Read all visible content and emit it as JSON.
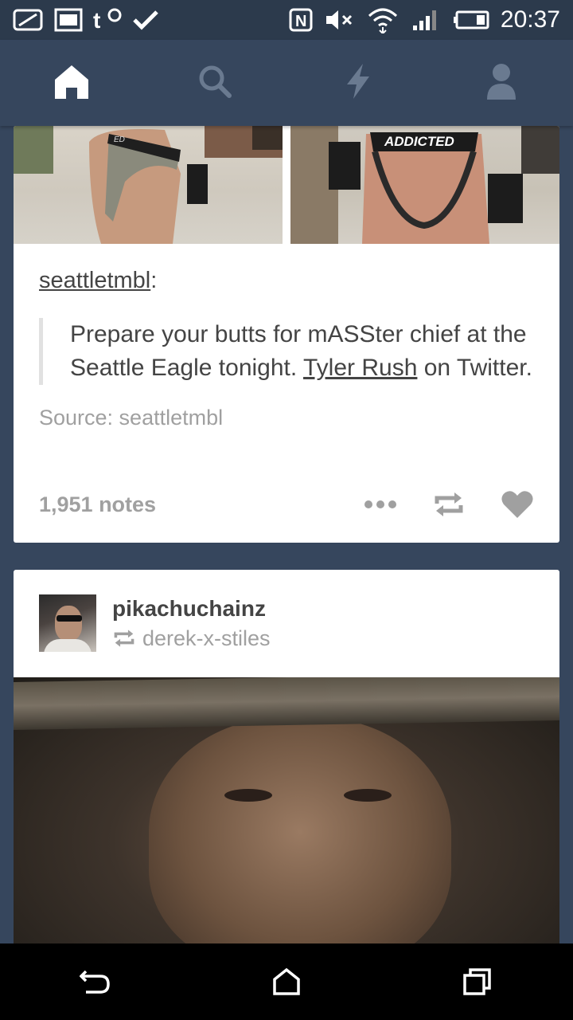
{
  "status_bar": {
    "time": "20:37",
    "left_icons": [
      "whatsapp-icon",
      "image-icon",
      "tumblr-notification-icon",
      "check-icon"
    ],
    "right_icons": [
      "nfc-icon",
      "mute-icon",
      "wifi-icon",
      "signal-icon",
      "battery-icon"
    ]
  },
  "nav": {
    "items": [
      {
        "icon": "home-icon",
        "active": true
      },
      {
        "icon": "search-icon",
        "active": false
      },
      {
        "icon": "activity-icon",
        "active": false
      },
      {
        "icon": "account-icon",
        "active": false
      }
    ]
  },
  "post1": {
    "reblog_user": "seattletmbl",
    "reblog_colon": ":",
    "quote_part1": "Prepare your butts for mASSter chief at the Seattle Eagle tonight.",
    "quote_link": "Tyler Rush",
    "quote_part2": "on Twitter.",
    "source": "Source: seattletmbl",
    "notes": "1,951 notes",
    "photo_b_label": "ADDICTED",
    "photo_a_label": "ED"
  },
  "post2": {
    "blog_name": "pikachuchainz",
    "reblogged_from": "derek-x-stiles"
  },
  "colors": {
    "background": "#36465d",
    "status_bar": "#2c3a4c",
    "text_primary": "#444444",
    "text_secondary": "#a0a0a0"
  }
}
